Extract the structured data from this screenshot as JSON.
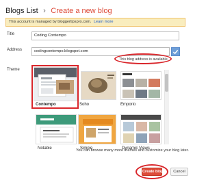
{
  "header": {
    "breadcrumb": "Blogs List",
    "separator": "›",
    "title": "Create a new blog"
  },
  "notice": {
    "text": "This account is managed by bloggertipspro.com.",
    "link": "Learn more"
  },
  "form": {
    "title_label": "Title",
    "title_value": "Coding Contempo",
    "address_label": "Address",
    "address_value": "codingcontempo.blogspot.com",
    "availability": "This blog address is available.",
    "theme_label": "Theme"
  },
  "themes": [
    {
      "name": "Contempo",
      "selected": true
    },
    {
      "name": "Soho",
      "selected": false
    },
    {
      "name": "Emporio",
      "selected": false
    },
    {
      "name": "Notable",
      "selected": false
    },
    {
      "name": "Simple",
      "selected": false
    },
    {
      "name": "Dynamic Views",
      "selected": false
    }
  ],
  "more_themes_text": "You can browse many more themes and customize your blog later.",
  "buttons": {
    "create": "Create blog",
    "cancel": "Cancel"
  },
  "colors": {
    "accent": "#dd4b39",
    "highlight": "#d9262b",
    "notice_bg": "#f9edbe",
    "check": "#6f9fd8"
  }
}
